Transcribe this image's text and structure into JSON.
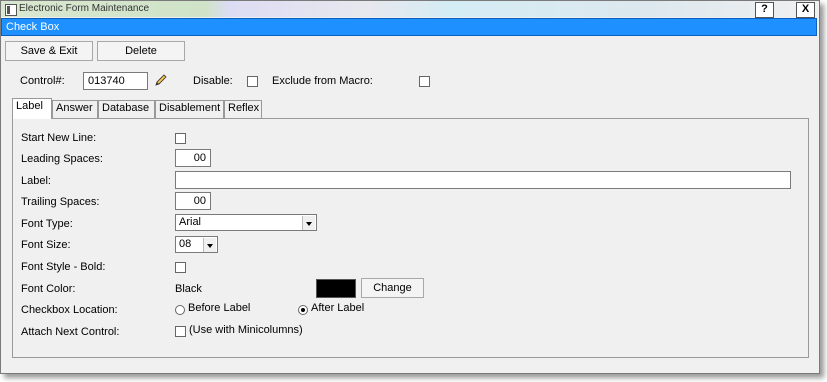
{
  "window": {
    "title": "Electronic Form Maintenance",
    "help_label": "?",
    "close_label": "X"
  },
  "caption": {
    "text": "Check Box"
  },
  "toolbar": {
    "save_exit_label": "Save & Exit",
    "delete_label": "Delete"
  },
  "control": {
    "control_label": "Control#:",
    "control_value": "013740",
    "disable_label": "Disable:",
    "exclude_label": "Exclude from Macro:"
  },
  "tabs": [
    "Label",
    "Answer",
    "Database",
    "Disablement",
    "Reflex"
  ],
  "label_tab": {
    "start_new_line_label": "Start New Line:",
    "leading_spaces_label": "Leading Spaces:",
    "leading_spaces_value": "00",
    "label_label": "Label:",
    "label_value": "",
    "trailing_spaces_label": "Trailing Spaces:",
    "trailing_spaces_value": "00",
    "font_type_label": "Font Type:",
    "font_type_value": "Arial",
    "font_size_label": "Font Size:",
    "font_size_value": "08",
    "font_style_label": "Font Style - Bold:",
    "font_color_label": "Font Color:",
    "font_color_value": "Black",
    "font_color_hex": "#000000",
    "change_label": "Change",
    "checkbox_location_label": "Checkbox Location:",
    "before_label": "Before Label",
    "after_label": "After Label",
    "checkbox_location_selected": "After Label",
    "attach_next_label": "Attach Next Control:",
    "attach_next_hint": "(Use with Minicolumns)"
  },
  "icons": {
    "pencil": "pencil-icon"
  }
}
